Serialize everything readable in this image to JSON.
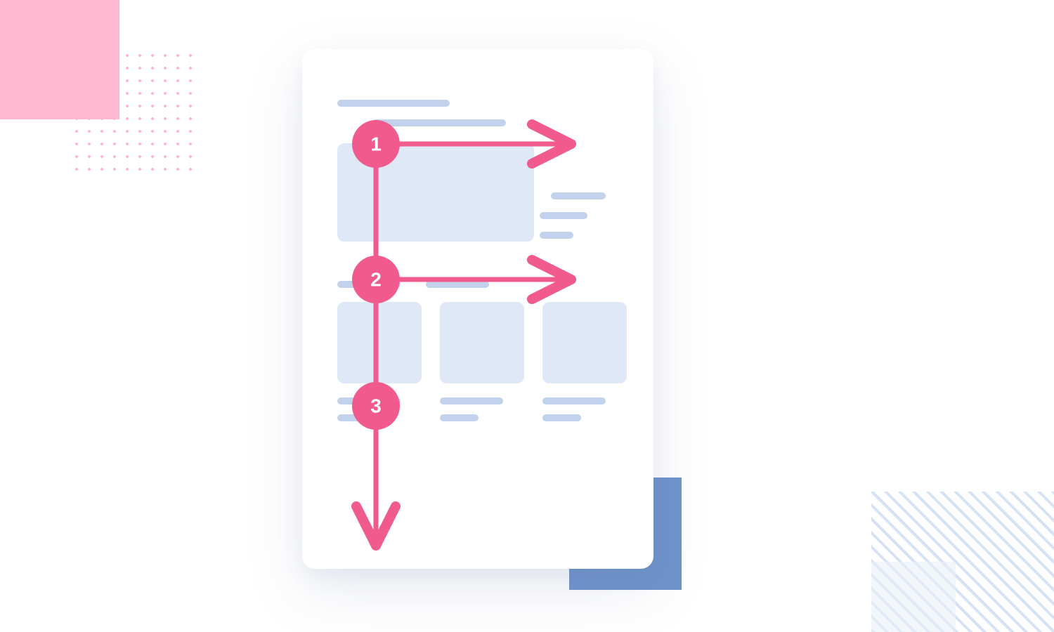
{
  "diagram": {
    "steps": [
      "1",
      "2",
      "3"
    ]
  },
  "colors": {
    "accent_pink": "#F15A8C",
    "light_pink": "#FFB8D0",
    "wireframe_fill": "#DEE8F6",
    "wireframe_stroke": "#C2D2EC",
    "blue_accent": "#6F94CC"
  }
}
